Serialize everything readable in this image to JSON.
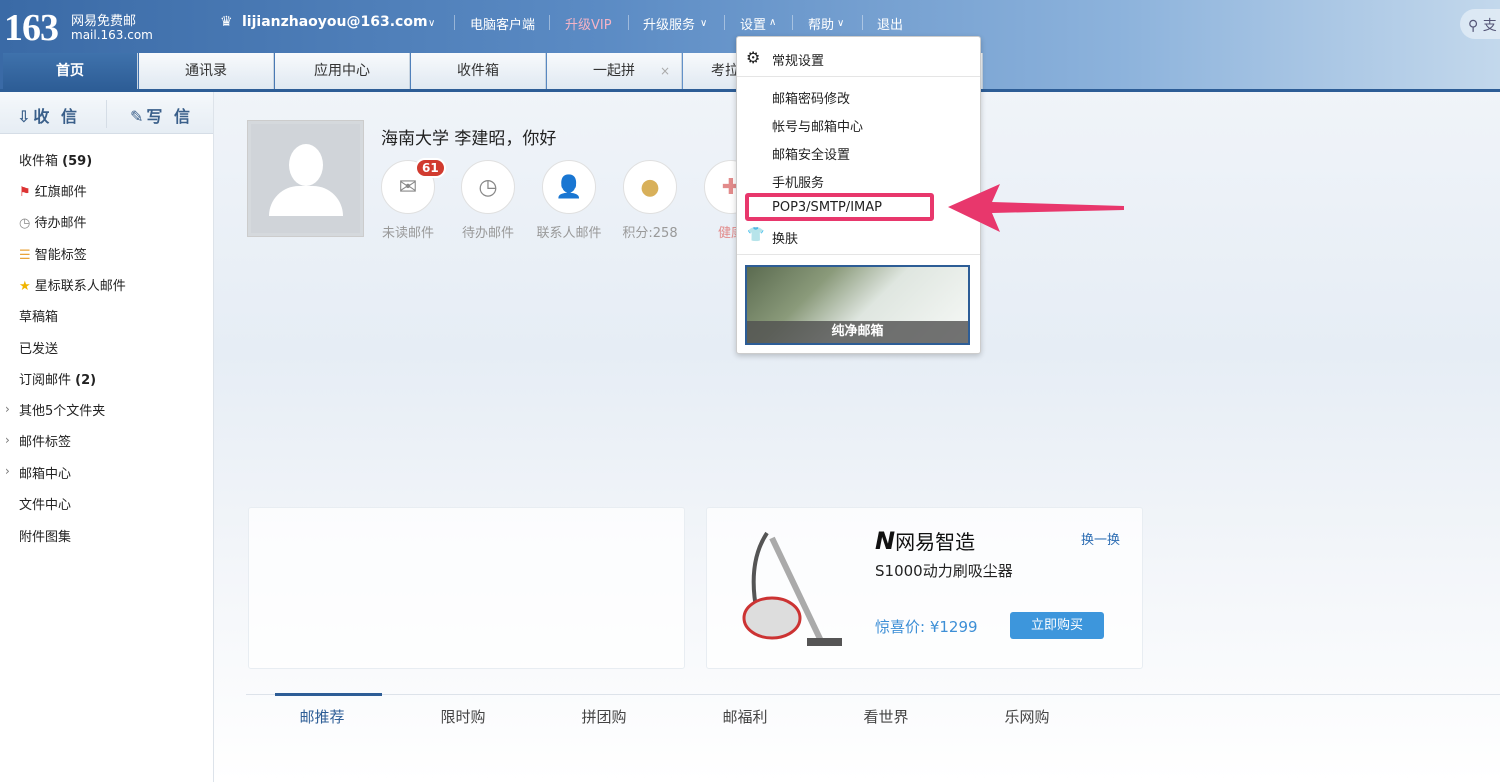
{
  "header": {
    "logo_number": "163",
    "logo_name": "网易免费邮",
    "logo_url": "mail.163.com",
    "account": "lijianzhaoyou@163.com",
    "nav": [
      "电脑客户端",
      "升级VIP",
      "升级服务",
      "设置",
      "帮助",
      "退出"
    ],
    "search_placeholder": "支"
  },
  "tabs": [
    {
      "label": "首页",
      "active": true
    },
    {
      "label": "通讯录"
    },
    {
      "label": "应用中心"
    },
    {
      "label": "收件箱"
    },
    {
      "label": "一起拼",
      "closable": true
    },
    {
      "label": "考拉"
    }
  ],
  "sidebar": {
    "receive": "收 信",
    "compose": "写 信",
    "folders": [
      {
        "label": "收件箱",
        "count": "(59)"
      },
      {
        "label": "红旗邮件",
        "icon": "flag-icon"
      },
      {
        "label": "待办邮件",
        "icon": "clock-icon"
      },
      {
        "label": "智能标签",
        "icon": "tag-icon"
      },
      {
        "label": "星标联系人邮件",
        "icon": "star-icon"
      },
      {
        "label": "草稿箱"
      },
      {
        "label": "已发送"
      },
      {
        "label": "订阅邮件",
        "count": "(2)"
      },
      {
        "label": "其他5个文件夹",
        "expandable": true
      },
      {
        "label": "邮件标签",
        "expandable": true
      },
      {
        "label": "邮箱中心",
        "expandable": true
      },
      {
        "label": "文件中心"
      },
      {
        "label": "附件图集"
      }
    ]
  },
  "profile": {
    "greeting": "海南大学 李建昭，你好",
    "unread_badge": "61",
    "quick": [
      "未读邮件",
      "待办邮件",
      "联系人邮件",
      "积分:258",
      "健康"
    ]
  },
  "settings_menu": {
    "general": "常规设置",
    "items": [
      "邮箱密码修改",
      "帐号与邮箱中心",
      "邮箱安全设置",
      "手机服务",
      "POP3/SMTP/IMAP"
    ],
    "skin": "换肤",
    "skin_preview": "纯净邮箱",
    "highlight_color": "#e8376c"
  },
  "ad": {
    "brand": "网易智造",
    "refresh": "换一换",
    "product": "S1000动力刷吸尘器",
    "price": "惊喜价: ¥1299",
    "buy": "立即购买"
  },
  "bottom_tabs": [
    "邮推荐",
    "限时购",
    "拼团购",
    "邮福利",
    "看世界",
    "乐网购"
  ]
}
